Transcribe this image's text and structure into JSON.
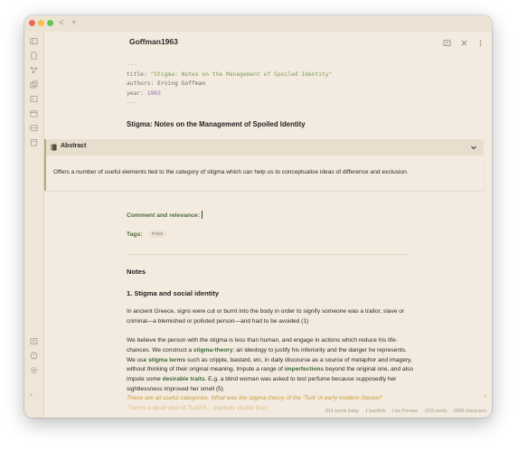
{
  "window": {
    "nav_back": "<",
    "nav_add": "+"
  },
  "ribbon_icons": [
    "file-explorer-icon",
    "file-icon",
    "graph-icon",
    "copy-icon",
    "terminal-icon",
    "calendar-icon",
    "layout-icon",
    "daily-note-icon"
  ],
  "ribbon_bottom_icons": [
    "vault-icon",
    "help-icon",
    "settings-icon"
  ],
  "note": {
    "title": "Goffman1963",
    "frontmatter": {
      "sep": "---",
      "title_key": "title:",
      "title_value": "\"Stigma: Notes on the Management of Spoiled Identity\"",
      "authors_key": "authors:",
      "authors_value": "Erving Goffman",
      "year_key": "year:",
      "year_value": "1963"
    },
    "heading": "Stigma: Notes on the Management of Spoiled Identity",
    "callout_label": "Abstract",
    "callout_text": "Offers a number of useful elements tied to the category of stigma which can help us to conceptualise ideas of difference and exclusion.",
    "comment_label": "Comment and relevance:",
    "tags_label": "Tags:",
    "tag": "#race",
    "notes_heading": "Notes",
    "section_heading": "1. Stigma and social identity",
    "p1": "In ancient Greece, signs were cut or burnt into the body in order to signify someone was a traitor, slave or criminal—a blemished or polluted person—and had to be avoided (1)",
    "p2": {
      "a": "We believe the person with the stigma is less than human, and engage in actions which reduce his life-chances. We construct a ",
      "b": "stigma-theory",
      "c": ": an ideology to justify his inferiority and the danger he represents. We use ",
      "d": "stigma terms",
      "e": " such as cripple, bastard, etc, in daily discourse as a source of metaphor and imagery, without thinking of their original meaning. Impute a range of ",
      "f": "imperfections",
      "g": " beyond the original one, and also impute some ",
      "h": "desirable traits",
      "i": ". E.g. a blind woman was asked to test perfume because supposedly her sightlessness improved her smell (5)"
    },
    "question": "These are all useful categories. What was the stigma theory of the 'Turk' in early modern Genoa?",
    "question_cut": "There's a good deal of Turkish... (partially visible line)"
  },
  "status": {
    "words_today": "814 words today",
    "backlink": "1 backlink",
    "mode": "Live Preview",
    "words": "1119 words",
    "chars": "6899 characters"
  },
  "colors": {
    "background": "#f3ebdf",
    "accent_green": "#3f6a3a",
    "string_green": "#7f9b57",
    "number_purple": "#8b6fb3",
    "question_gold": "#c99b3e"
  }
}
